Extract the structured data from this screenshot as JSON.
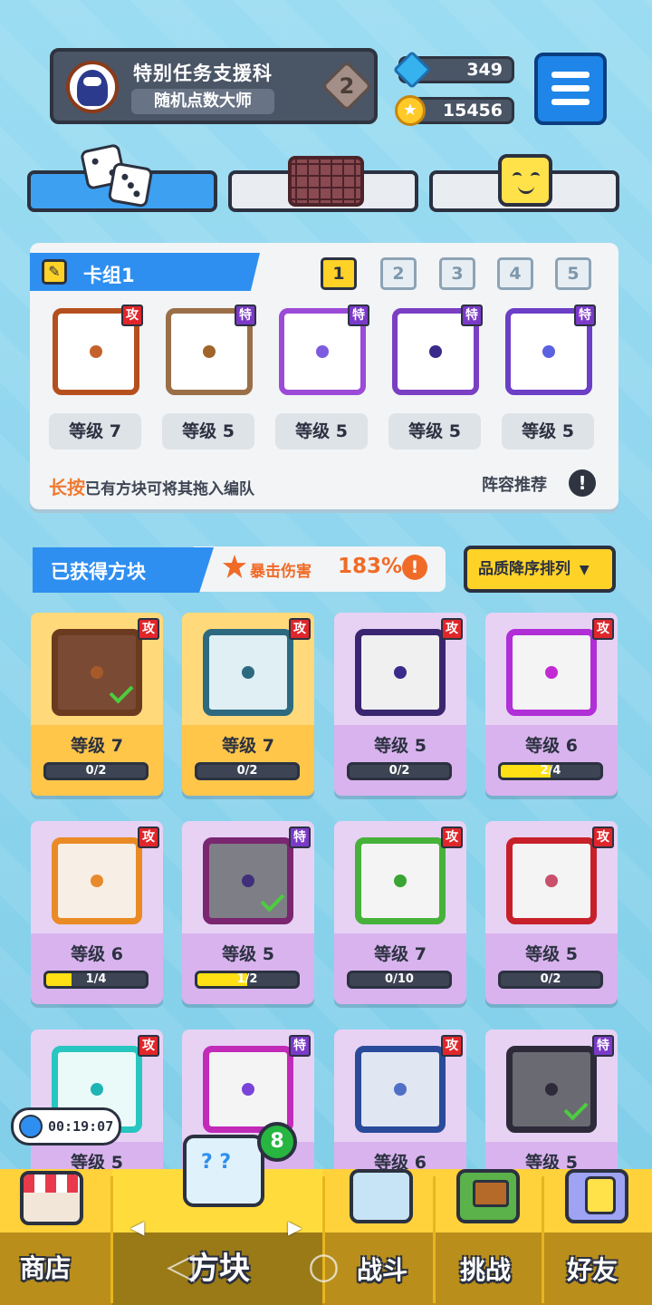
{
  "profile": {
    "name": "特别任务支援科",
    "title": "随机点数大师",
    "rank": "2"
  },
  "currency": {
    "gems": "349",
    "gold": "15456",
    "gem_icon": "gem-icon",
    "gold_icon": "coin-icon"
  },
  "deck": {
    "title": "卡组1",
    "tabs": [
      "1",
      "2",
      "3",
      "4",
      "5"
    ],
    "selected_tab": "1",
    "slots": [
      {
        "tag": "攻",
        "level": "等级 7",
        "color": "#b5501e",
        "dot": "#c5622c"
      },
      {
        "tag": "特",
        "level": "等级 5",
        "color": "#9a6f47",
        "dot": "#a0652a"
      },
      {
        "tag": "特",
        "level": "等级 5",
        "color": "#9b4bd8",
        "dot": "#7d5ce0"
      },
      {
        "tag": "特",
        "level": "等级 5",
        "color": "#7a3fc2",
        "dot": "#3a2a8a"
      },
      {
        "tag": "特",
        "level": "等级 5",
        "color": "#6b3fc6",
        "dot": "#5a62e0"
      }
    ],
    "hint_highlight": "长按",
    "hint_rest": "已有方块可将其拖入编队",
    "recommend": "阵容推荐",
    "excl": "!"
  },
  "owned": {
    "title": "已获得方块",
    "crit_label": "暴击伤害",
    "crit_value": "183%",
    "crit_excl": "!",
    "sort_label": "品质降序排列",
    "sort_arrow": "▼",
    "cards": [
      {
        "tag": "攻",
        "level": "等级 7",
        "progress": "0/2",
        "fill": 0,
        "gold": true,
        "frame": "#6b3a1f",
        "bg": "#7a4a34",
        "dot": "#a65a2a",
        "check": true
      },
      {
        "tag": "攻",
        "level": "等级 7",
        "progress": "0/2",
        "fill": 0,
        "gold": true,
        "frame": "#2d6a80",
        "bg": "#dfeff3",
        "dot": "#2d6a80",
        "check": false
      },
      {
        "tag": "攻",
        "level": "等级 5",
        "progress": "0/2",
        "fill": 0,
        "gold": false,
        "frame": "#3a2670",
        "bg": "#f0f0f0",
        "dot": "#3a2a8a",
        "check": false
      },
      {
        "tag": "攻",
        "level": "等级 6",
        "progress": "2/4",
        "fill": 0.5,
        "gold": false,
        "frame": "#b02fd6",
        "bg": "#f4f4f4",
        "dot": "#c22ad4",
        "check": false
      },
      {
        "tag": "攻",
        "level": "等级 6",
        "progress": "1/4",
        "fill": 0.25,
        "gold": false,
        "frame": "#ea8a25",
        "bg": "#f7efe6",
        "dot": "#e88a2c",
        "check": false
      },
      {
        "tag": "特",
        "level": "等级 5",
        "progress": "1/2",
        "fill": 0.5,
        "gold": false,
        "frame": "#7a2670",
        "bg": "#7e7e86",
        "dot": "#40307a",
        "check": true
      },
      {
        "tag": "攻",
        "level": "等级 7",
        "progress": "0/10",
        "fill": 0,
        "gold": false,
        "frame": "#46b23a",
        "bg": "#f4f4f4",
        "dot": "#3aa534",
        "check": false
      },
      {
        "tag": "攻",
        "level": "等级 5",
        "progress": "0/2",
        "fill": 0,
        "gold": false,
        "frame": "#c8202a",
        "bg": "#f4f4f4",
        "dot": "#c8506a",
        "check": false
      },
      {
        "tag": "攻",
        "level": "等级 5",
        "gold": false,
        "frame": "#27c6c0",
        "bg": "#eafaf9",
        "dot": "#1fb3b3",
        "check": false
      },
      {
        "tag": "特",
        "level": "",
        "gold": false,
        "frame": "#c22ab8",
        "bg": "#f4f4f4",
        "dot": "#7a44d8",
        "check": false
      },
      {
        "tag": "攻",
        "level": "等级 6",
        "gold": false,
        "frame": "#2a4a9a",
        "bg": "#e0e6f2",
        "dot": "#5070c8",
        "check": false
      },
      {
        "tag": "特",
        "level": "等级 5",
        "gold": false,
        "frame": "#2e2a3a",
        "bg": "#6a6a72",
        "dot": "#2e2a3a",
        "check": true
      }
    ]
  },
  "timer": "00:19:07",
  "nav": {
    "shop": "商店",
    "blocks": "方块",
    "battle": "战斗",
    "challenge": "挑战",
    "friends": "好友",
    "badge": "8",
    "arrow_left": "◀",
    "arrow_right": "▶",
    "sys_back": "◁",
    "sys_home": "○"
  }
}
